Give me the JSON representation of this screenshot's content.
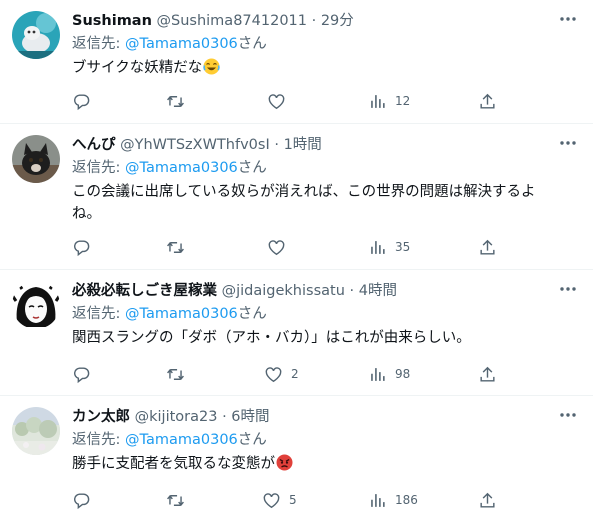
{
  "tweets": [
    {
      "name": "Sushiman",
      "handle": "@Sushima87412011",
      "dot": "·",
      "time": "29分",
      "reply_prefix": "返信先: ",
      "reply_to": "@Tamama0306",
      "reply_suffix": "さん",
      "text": "ブサイクな妖精だな",
      "emoji": "face-with-tears-of-joy",
      "counts": {
        "reply": "",
        "retweet": "",
        "like": "",
        "views": "12"
      }
    },
    {
      "name": "へんぴ",
      "handle": "@YhWTSzXWThfv0sI",
      "dot": "·",
      "time": "1時間",
      "reply_prefix": "返信先: ",
      "reply_to": "@Tamama0306",
      "reply_suffix": "さん",
      "text_line1": "この会議に出席している奴らが消えれば、この世界の問題は解決するよ",
      "text_line2": "ね。",
      "counts": {
        "reply": "",
        "retweet": "",
        "like": "",
        "views": "35"
      }
    },
    {
      "name": "必殺必転しごき屋稼業",
      "handle": "@jidaigekhissatu",
      "dot": "·",
      "time": "4時間",
      "reply_prefix": "返信先: ",
      "reply_to": "@Tamama0306",
      "reply_suffix": "さん",
      "text": "関西スラングの「ダボ（アホ・バカ）」はこれが由来らしい。",
      "counts": {
        "reply": "",
        "retweet": "",
        "like": "2",
        "views": "98"
      }
    },
    {
      "name": "カン太郎",
      "handle": "@kijitora23",
      "dot": "·",
      "time": "6時間",
      "reply_prefix": "返信先: ",
      "reply_to": "@Tamama0306",
      "reply_suffix": "さん",
      "text": "勝手に支配者を気取るな変態が",
      "emoji": "angry-face",
      "counts": {
        "reply": "",
        "retweet": "",
        "like": "5",
        "views": "186"
      }
    }
  ],
  "colors": {
    "text": "#0f1419",
    "muted": "#536471",
    "link": "#1d9bf0",
    "divider": "#eff3f4"
  }
}
